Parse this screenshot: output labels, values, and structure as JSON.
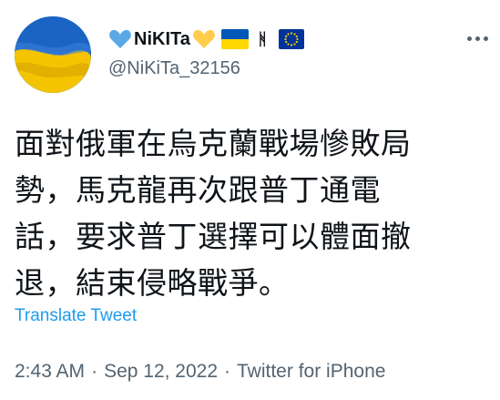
{
  "user": {
    "display_name": "NiKITa",
    "handle": "@NiKiTa_32156",
    "name_emojis": [
      "blue-heart",
      "yellow-heart",
      "ukraine-flag",
      "rune-symbol",
      "eu-flag"
    ]
  },
  "tweet": {
    "lines": [
      "面對俄軍在烏克蘭戰場慘敗局",
      "勢，馬克龍再次跟普丁通電",
      "話，要求普丁選擇可以體面撤",
      "退，結束侵略戰爭。"
    ],
    "translate_label": "Translate Tweet",
    "time": "2:43 AM",
    "date": "Sep 12, 2022",
    "source": "Twitter for iPhone",
    "separator": "·"
  },
  "colors": {
    "text": "#0f1419",
    "secondary": "#536471",
    "link": "#1d9bf0",
    "ukraine_blue": "#0057b7",
    "ukraine_yellow": "#ffd700"
  }
}
